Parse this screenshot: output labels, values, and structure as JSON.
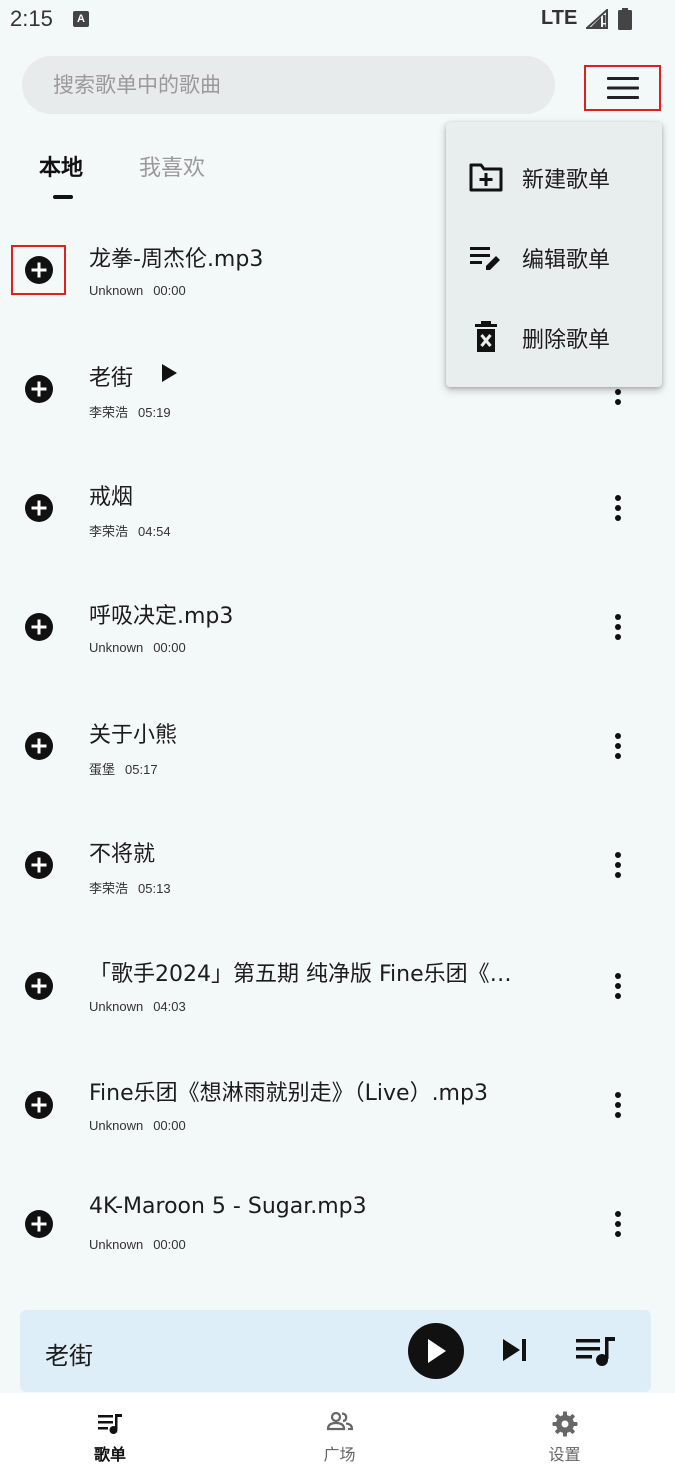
{
  "status_bar": {
    "time": "2:15",
    "keyboard_badge": "A",
    "network": "LTE"
  },
  "search": {
    "placeholder": "搜索歌单中的歌曲",
    "value": ""
  },
  "tabs": [
    {
      "label": "本地",
      "active": true
    },
    {
      "label": "我喜欢",
      "active": false
    }
  ],
  "songs": [
    {
      "title": "龙拳-周杰伦.mp3",
      "artist": "Unknown",
      "duration": "00:00",
      "playing": false
    },
    {
      "title": "老街",
      "artist": "李荣浩",
      "duration": "05:19",
      "playing": true
    },
    {
      "title": "戒烟",
      "artist": "李荣浩",
      "duration": "04:54",
      "playing": false
    },
    {
      "title": "呼吸决定.mp3",
      "artist": "Unknown",
      "duration": "00:00",
      "playing": false
    },
    {
      "title": "关于小熊",
      "artist": "蛋堡",
      "duration": "05:17",
      "playing": false
    },
    {
      "title": "不将就",
      "artist": "李荣浩",
      "duration": "05:13",
      "playing": false
    },
    {
      "title": "「歌手2024」第五期 纯净版 Fine乐团《…",
      "artist": "Unknown",
      "duration": "04:03",
      "playing": false
    },
    {
      "title": "Fine乐团《想淋雨就别走》（Live）.mp3",
      "artist": "Unknown",
      "duration": "00:00",
      "playing": false
    },
    {
      "title": "4K-Maroon 5 - Sugar.mp3",
      "artist": "Unknown",
      "duration": "00:00",
      "playing": false
    }
  ],
  "popup_menu": {
    "items": [
      {
        "label": "新建歌单",
        "icon": "create-folder-icon"
      },
      {
        "label": "编辑歌单",
        "icon": "edit-list-icon"
      },
      {
        "label": "删除歌单",
        "icon": "delete-icon"
      }
    ]
  },
  "mini_player": {
    "title": "老街"
  },
  "bottom_nav": [
    {
      "label": "歌单",
      "icon": "playlist-icon",
      "active": true
    },
    {
      "label": "广场",
      "icon": "people-icon",
      "active": false
    },
    {
      "label": "设置",
      "icon": "gear-icon",
      "active": false
    }
  ],
  "colors": {
    "highlight_border": "#e02020",
    "mini_player_bg": "#deeef8",
    "page_bg": "#f3f8f8"
  }
}
